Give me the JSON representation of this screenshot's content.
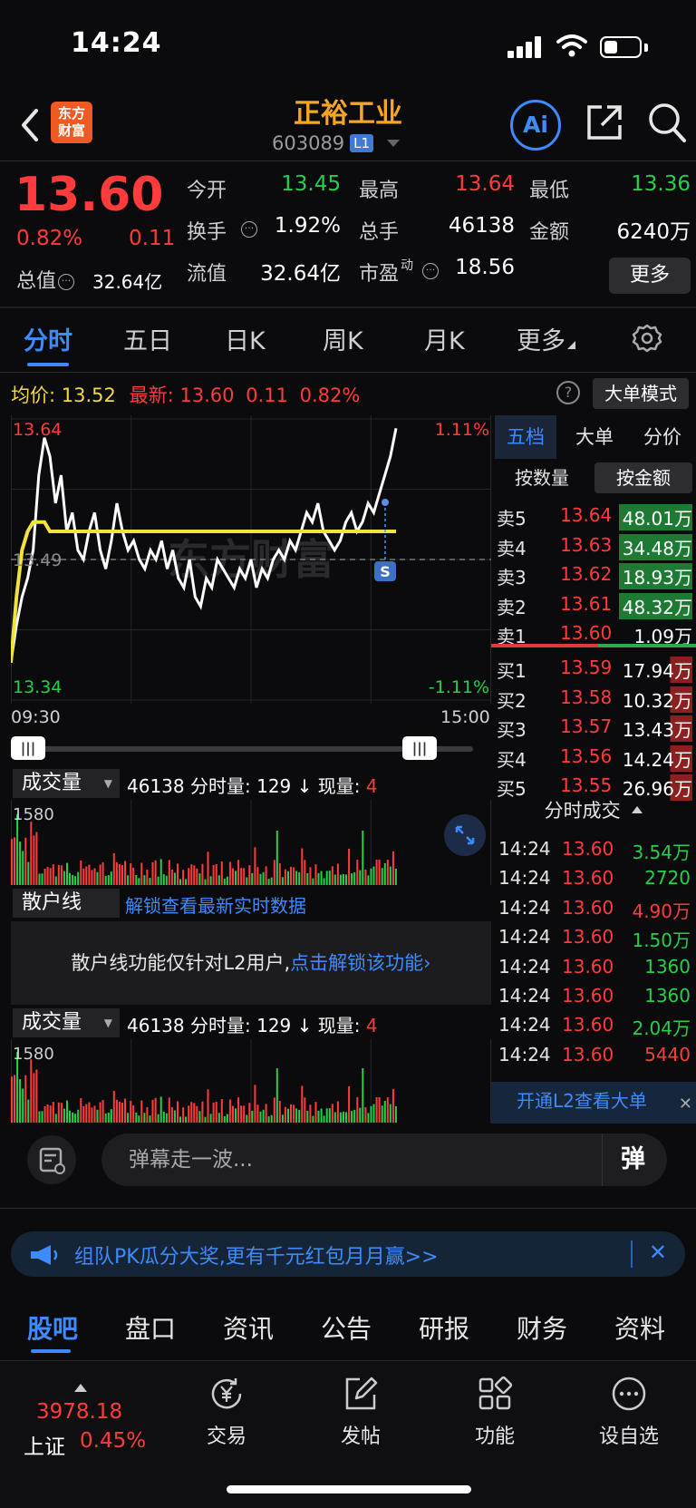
{
  "status_bar": {
    "time": "14:24"
  },
  "header": {
    "logo_text_line1": "东方",
    "logo_text_line2": "财富",
    "stock_name": "正裕工业",
    "stock_code": "603089",
    "level_badge": "L1",
    "ai_label": "Ai"
  },
  "quote": {
    "price": "13.60",
    "change_pct": "0.82%",
    "change": "0.11",
    "mktcap_label": "总值",
    "mktcap_value": "32.64亿",
    "more_label": "更多",
    "fields": [
      {
        "label": "今开",
        "value": "13.45",
        "color": "green"
      },
      {
        "label": "最高",
        "value": "13.64",
        "color": "red"
      },
      {
        "label": "最低",
        "value": "13.36",
        "color": "green"
      },
      {
        "label": "换手",
        "value": "1.92%",
        "color": "white"
      },
      {
        "label": "总手",
        "value": "46138",
        "color": "white"
      },
      {
        "label": "金额",
        "value": "6240万",
        "color": "white"
      },
      {
        "label": "流值",
        "value": "32.64亿",
        "color": "white"
      },
      {
        "label": "市盈",
        "label_sup": "动",
        "value": "18.56",
        "color": "white"
      }
    ]
  },
  "period_tabs": [
    "分时",
    "五日",
    "日K",
    "周K",
    "月K",
    "更多"
  ],
  "avg_row": {
    "avg_label": "均价:",
    "avg_value": "13.52",
    "latest_label": "最新:",
    "latest_value": "13.60",
    "latest_change": "0.11",
    "latest_pct": "0.82%"
  },
  "bigorder_label": "大单模式",
  "chart": {
    "y_top_label": "13.64",
    "y_mid_label": "13.49",
    "y_bottom_label": "13.34",
    "pct_top": "1.11%",
    "pct_bottom": "-1.11%",
    "time_start": "09:30",
    "time_end": "15:00",
    "signal_label": "S",
    "watermark": "东方财富"
  },
  "chart_data": {
    "type": "line",
    "title": "",
    "xlabel": "",
    "ylabel": "",
    "ylim": [
      13.34,
      13.64
    ],
    "reference_price": 13.49,
    "x_range": [
      "09:30",
      "15:00"
    ],
    "series": [
      {
        "name": "最新",
        "values": [
          13.38,
          13.42,
          13.45,
          13.47,
          13.5,
          13.58,
          13.62,
          13.6,
          13.55,
          13.58,
          13.52,
          13.54,
          13.5,
          13.49,
          13.52,
          13.54,
          13.5,
          13.48,
          13.51,
          13.55,
          13.52,
          13.5,
          13.51,
          13.49,
          13.48,
          13.5,
          13.49,
          13.51,
          13.48,
          13.5,
          13.47,
          13.46,
          13.49,
          13.45,
          13.44,
          13.47,
          13.46,
          13.49,
          13.48,
          13.47,
          13.46,
          13.48,
          13.47,
          13.49,
          13.46,
          13.48,
          13.47,
          13.49,
          13.5,
          13.49,
          13.51,
          13.5,
          13.52,
          13.54,
          13.53,
          13.55,
          13.52,
          13.51,
          13.5,
          13.51,
          13.53,
          13.54,
          13.52,
          13.53,
          13.55,
          13.54,
          13.56,
          13.58,
          13.6,
          13.63
        ]
      },
      {
        "name": "均价",
        "values": [
          13.38,
          13.45,
          13.5,
          13.52,
          13.53,
          13.53,
          13.53,
          13.52,
          13.52,
          13.52,
          13.52,
          13.52,
          13.52,
          13.52,
          13.52,
          13.52,
          13.52,
          13.52,
          13.52,
          13.52,
          13.52,
          13.52,
          13.52,
          13.52,
          13.52,
          13.52,
          13.52,
          13.52,
          13.52,
          13.52,
          13.52,
          13.52,
          13.52,
          13.52,
          13.52,
          13.52,
          13.52,
          13.52,
          13.52,
          13.52,
          13.52,
          13.52,
          13.52,
          13.52,
          13.52,
          13.52,
          13.52,
          13.52,
          13.52,
          13.52,
          13.52,
          13.52,
          13.52,
          13.52,
          13.52,
          13.52,
          13.52,
          13.52,
          13.52,
          13.52,
          13.52,
          13.52,
          13.52,
          13.52,
          13.52,
          13.52,
          13.52,
          13.52,
          13.52,
          13.52
        ]
      }
    ],
    "volume_max": 1580,
    "grid": true
  },
  "volume": {
    "selector": "成交量",
    "total": "46138",
    "period_label": "分时量:",
    "period_value": "129",
    "arrow": "↓",
    "current_label": "现量:",
    "current_value": "4",
    "max_label": "1580"
  },
  "retail": {
    "label": "散户线",
    "link": "解锁查看最新实时数据",
    "msg": "散户线功能仅针对L2用户,",
    "msg_link": "点击解锁该功能"
  },
  "order_book": {
    "tabs": [
      "五档",
      "大单",
      "分价"
    ],
    "subtabs": [
      "按数量",
      "按金额"
    ],
    "asks": [
      {
        "label": "卖5",
        "price": "13.64",
        "vol": "48.01万",
        "bar": "green"
      },
      {
        "label": "卖4",
        "price": "13.63",
        "vol": "34.48万",
        "bar": "green"
      },
      {
        "label": "卖3",
        "price": "13.62",
        "vol": "18.93万",
        "bar": "green"
      },
      {
        "label": "卖2",
        "price": "13.61",
        "vol": "48.32万",
        "bar": "green"
      },
      {
        "label": "卖1",
        "price": "13.60",
        "vol": "1.09万",
        "bar": "none"
      }
    ],
    "bids": [
      {
        "label": "买1",
        "price": "13.59",
        "vol": "17.94万",
        "bar": "red"
      },
      {
        "label": "买2",
        "price": "13.58",
        "vol": "10.32万",
        "bar": "red"
      },
      {
        "label": "买3",
        "price": "13.57",
        "vol": "13.43万",
        "bar": "red"
      },
      {
        "label": "买4",
        "price": "13.56",
        "vol": "14.24万",
        "bar": "red"
      },
      {
        "label": "买5",
        "price": "13.55",
        "vol": "26.96万",
        "bar": "red"
      }
    ],
    "tick_header": "分时成交",
    "ticks": [
      {
        "time": "14:24",
        "price": "13.60",
        "vol": "3.54万",
        "color": "green"
      },
      {
        "time": "14:24",
        "price": "13.60",
        "vol": "2720",
        "color": "green"
      },
      {
        "time": "14:24",
        "price": "13.60",
        "vol": "4.90万",
        "color": "red"
      },
      {
        "time": "14:24",
        "price": "13.60",
        "vol": "1.50万",
        "color": "green"
      },
      {
        "time": "14:24",
        "price": "13.60",
        "vol": "1360",
        "color": "green"
      },
      {
        "time": "14:24",
        "price": "13.60",
        "vol": "1360",
        "color": "green"
      },
      {
        "time": "14:24",
        "price": "13.60",
        "vol": "2.04万",
        "color": "green"
      },
      {
        "time": "14:24",
        "price": "13.60",
        "vol": "5440",
        "color": "red"
      }
    ],
    "l2_banner": "开通L2查看大单"
  },
  "danmaku": {
    "placeholder": "弹幕走一波...",
    "send": "弹"
  },
  "promo": {
    "text": "组队PK瓜分大奖,更有千元红包月月赢>>"
  },
  "content_tabs": [
    "股吧",
    "盘口",
    "资讯",
    "公告",
    "研报",
    "财务",
    "资料"
  ],
  "bottom_nav": {
    "index_value": "3978.18",
    "index_name": "上证",
    "index_pct": "0.45%",
    "items": [
      "交易",
      "发帖",
      "功能",
      "设自选"
    ]
  },
  "colors": {
    "up": "#ff3b3b",
    "down": "#22d14a",
    "accent": "#3d8bff",
    "avg": "#f2e33c",
    "brand": "#f05a22"
  }
}
